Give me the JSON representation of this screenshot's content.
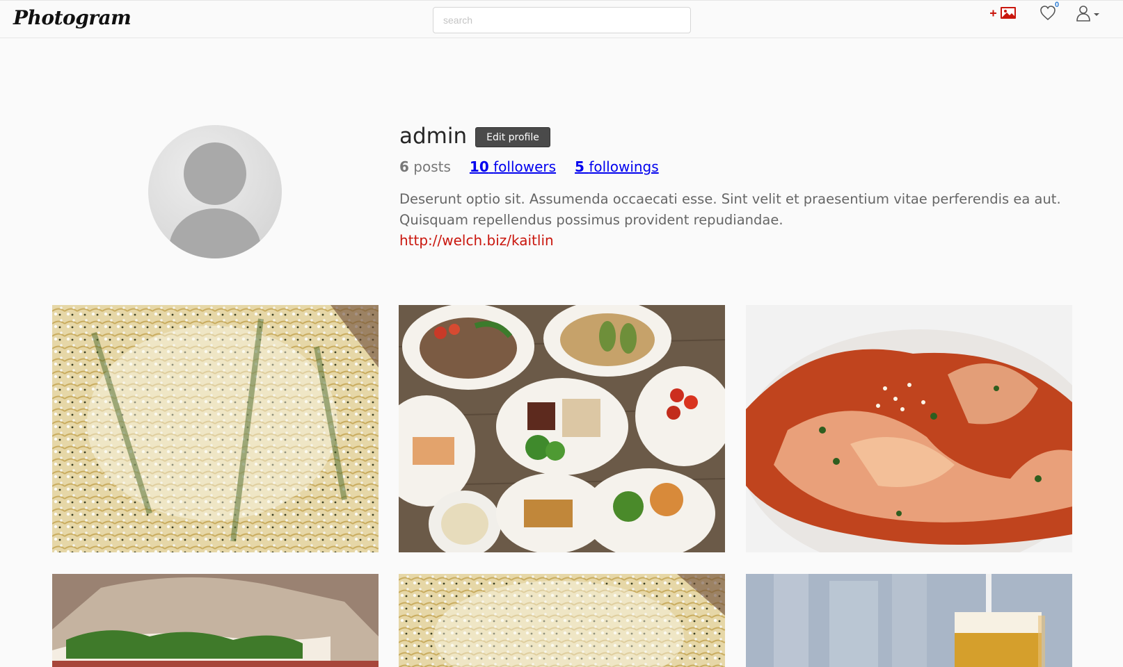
{
  "navbar": {
    "brand": "Photogram",
    "search_placeholder": "search",
    "notification_count": "0",
    "colors": {
      "add_icon": "#c9160d",
      "notification_count": "#2f7fd6"
    }
  },
  "profile": {
    "username": "admin",
    "edit_label": "Edit profile",
    "stats": {
      "posts_count": "6",
      "posts_label": "posts",
      "followers_count": "10",
      "followers_label": "followers",
      "followings_count": "5",
      "followings_label": "followings"
    },
    "bio": "Deserunt optio sit. Assumenda occaecati esse. Sint velit et praesentium vitae perferendis ea aut. Quisquam repellendus possimus provident repudiandae.",
    "website": "http://welch.biz/kaitlin",
    "colors": {
      "website": "#c9160d"
    }
  },
  "posts": [
    {
      "subject": "pasta with grated cheese"
    },
    {
      "subject": "table of plated dishes"
    },
    {
      "subject": "pappardelle with meat sauce"
    },
    {
      "subject": "sandwich with greens"
    },
    {
      "subject": "pasta with grated cheese"
    },
    {
      "subject": "glass of beer"
    }
  ]
}
